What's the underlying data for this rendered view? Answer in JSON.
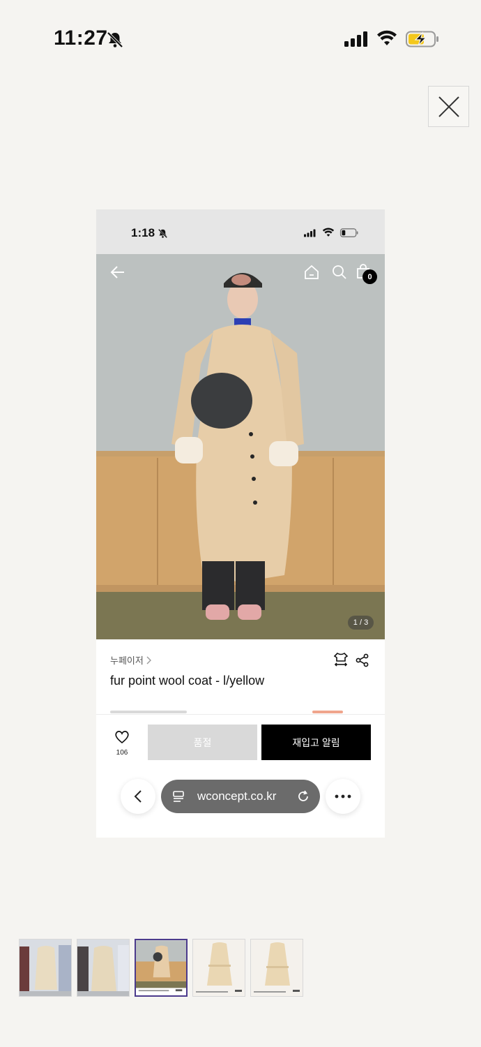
{
  "status_bar": {
    "time": "11:27"
  },
  "inner_screen": {
    "status_bar": {
      "time": "1:18"
    },
    "header": {
      "cart_count": "0"
    },
    "image_counter": "1 / 3",
    "product": {
      "brand": "누페이저",
      "title": "fur point wool coat - l/yellow"
    },
    "actions": {
      "wishlist_count": "106",
      "soldout_label": "품절",
      "restock_label": "재입고 알림"
    },
    "browser": {
      "url": "wconcept.co.kr"
    }
  },
  "thumbnails": [
    {
      "name": "thumb-1",
      "active": false
    },
    {
      "name": "thumb-2",
      "active": false
    },
    {
      "name": "thumb-3",
      "active": true
    },
    {
      "name": "thumb-4",
      "active": false
    },
    {
      "name": "thumb-5",
      "active": false
    }
  ],
  "colors": {
    "accent_thumb_border": "#4b3a8c",
    "cta_black": "#000000",
    "soldout_gray": "#d9d9d9"
  }
}
